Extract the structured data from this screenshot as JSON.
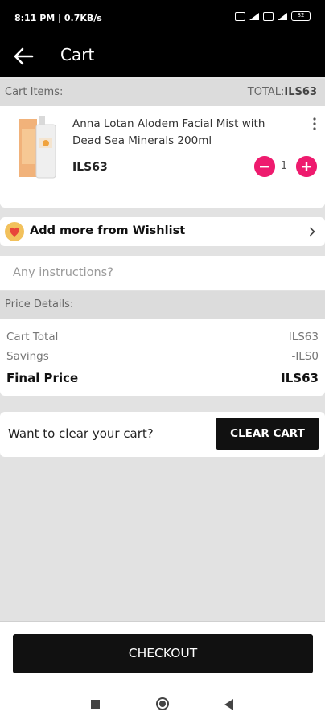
{
  "status_bar": {
    "time": "8:11 PM | 0.7KB/s",
    "battery": "82"
  },
  "app_bar": {
    "title": "Cart"
  },
  "cart": {
    "section_label": "Cart Items:",
    "total_label": "TOTAL:",
    "total_value": "ILS63",
    "item": {
      "name": "Anna Lotan Alodem Facial Mist with Dead Sea Minerals 200ml",
      "price": "ILS63",
      "quantity": "1"
    }
  },
  "wishlist": {
    "label": "Add more from Wishlist"
  },
  "instructions": {
    "placeholder": "Any instructions?"
  },
  "price_details": {
    "section_label": "Price Details:",
    "rows": [
      {
        "label": "Cart Total",
        "value": "ILS63"
      },
      {
        "label": "Savings",
        "value": "-ILS0"
      },
      {
        "label": "Final Price",
        "value": "ILS63"
      }
    ]
  },
  "clear_cart": {
    "prompt": "Want to clear your cart?",
    "button": "CLEAR CART"
  },
  "checkout": {
    "button": "CHECKOUT"
  },
  "colors": {
    "accent": "#ee1b6e",
    "dark": "#111111",
    "heart": "#e8443a",
    "heart_bg": "#f2c15c"
  }
}
